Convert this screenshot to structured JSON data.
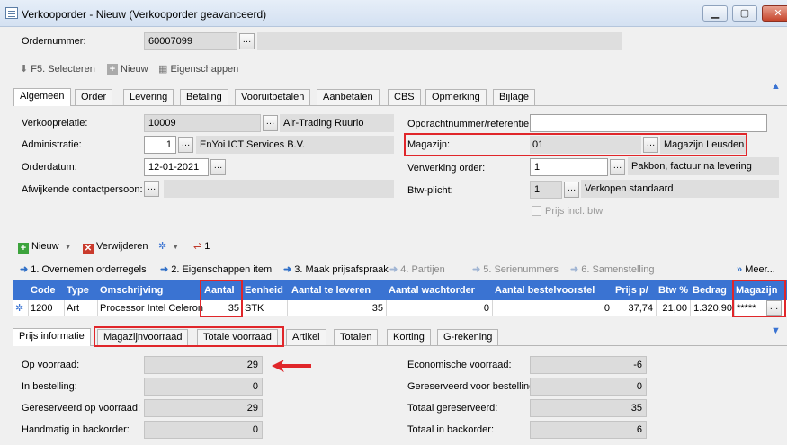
{
  "window": {
    "title": "Verkooporder - Nieuw (Verkooporder geavanceerd)",
    "min": "▁",
    "max": "▢",
    "close": "✕"
  },
  "header": {
    "ordernummer_label": "Ordernummer:",
    "ordernummer": "60007099"
  },
  "toolbar": {
    "f5": "F5. Selecteren",
    "nieuw": "Nieuw",
    "eigenschappen": "Eigenschappen"
  },
  "tabs": [
    "Algemeen",
    "Order",
    "Levering",
    "Betaling",
    "Vooruitbetalen",
    "Aanbetalen",
    "CBS",
    "Opmerking",
    "Bijlage"
  ],
  "form_left": {
    "verkooprelatie_label": "Verkooprelatie:",
    "verkooprelatie": "10009",
    "verkooprelatie_name": "Air-Trading Ruurlo",
    "administratie_label": "Administratie:",
    "administratie": "1",
    "administratie_name": "EnYoi ICT Services B.V.",
    "orderdatum_label": "Orderdatum:",
    "orderdatum": "12-01-2021",
    "contact_label": "Afwijkende contactpersoon:"
  },
  "form_right": {
    "opdracht_label": "Opdrachtnummer/referentie:",
    "opdracht": "",
    "magazijn_label": "Magazijn:",
    "magazijn": "01",
    "magazijn_name": "Magazijn Leusden",
    "verwerking_label": "Verwerking order:",
    "verwerking": "1",
    "verwerking_name": "Pakbon, factuur na levering",
    "btw_label": "Btw-plicht:",
    "btw": "1",
    "btw_name": "Verkopen standaard",
    "prijs_incl": "Prijs incl. btw"
  },
  "lines_toolbar": {
    "nieuw": "Nieuw",
    "verwijderen": "Verwijderen",
    "count": "1"
  },
  "steps": [
    "1. Overnemen orderregels",
    "2. Eigenschappen item",
    "3. Maak prijsafspraak",
    "4. Partijen",
    "5. Serienummers",
    "6. Samenstelling"
  ],
  "meer": "Meer...",
  "grid": {
    "columns": [
      "Code",
      "Type",
      "Omschrijving",
      "Aantal",
      "Eenheid",
      "Aantal te leveren",
      "Aantal wachtorder",
      "Aantal bestelvoorstel",
      "Prijs p/",
      "Btw %",
      "Bedrag",
      "Magazijn"
    ],
    "row": {
      "code": "1200",
      "type": "Art",
      "omschrijving": "Processor Intel Celeron",
      "aantal": "35",
      "eenheid": "STK",
      "te_leveren": "35",
      "wachtorder": "0",
      "bestelvoorstel": "0",
      "prijs": "37,74",
      "btw": "21,00",
      "bedrag": "1.320,90",
      "magazijn": "*****"
    }
  },
  "bottom_tabs": [
    "Prijs informatie",
    "Magazijnvoorraad",
    "Totale voorraad",
    "Artikel",
    "Totalen",
    "Korting",
    "G-rekening"
  ],
  "stock_left": [
    {
      "label": "Op voorraad:",
      "value": "29"
    },
    {
      "label": "In bestelling:",
      "value": "0"
    },
    {
      "label": "Gereserveerd op voorraad:",
      "value": "29"
    },
    {
      "label": "Handmatig in backorder:",
      "value": "0"
    }
  ],
  "stock_right": [
    {
      "label": "Economische voorraad:",
      "value": "-6"
    },
    {
      "label": "Gereserveerd voor bestelling:",
      "value": "0"
    },
    {
      "label": "Totaal gereserveerd:",
      "value": "35"
    },
    {
      "label": "Totaal in backorder:",
      "value": "6"
    }
  ],
  "colors": {
    "accent": "#3a73d2",
    "highlight": "#e0262a"
  }
}
